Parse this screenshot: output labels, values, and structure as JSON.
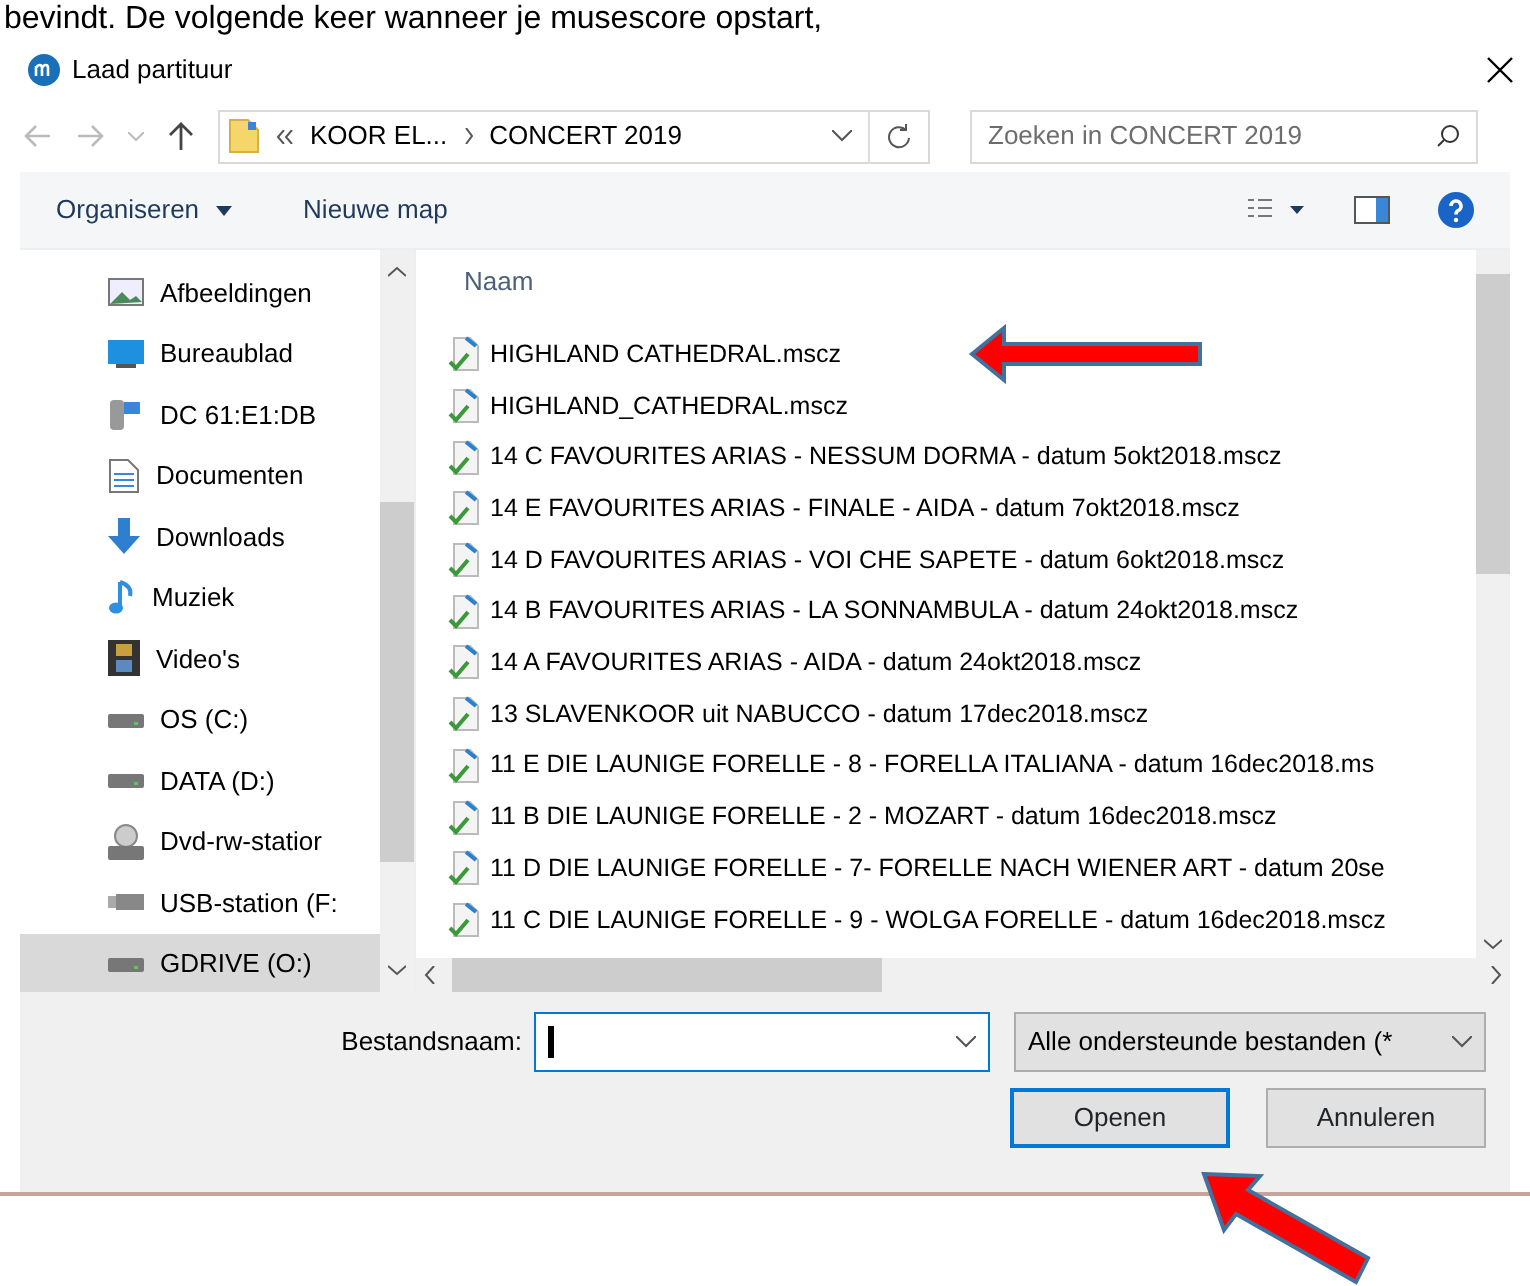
{
  "caption": "bevindt. De volgende keer wanneer je musescore opstart,",
  "window": {
    "title": "Laad partituur"
  },
  "address": {
    "crumbs": [
      "KOOR EL...",
      "CONCERT 2019"
    ]
  },
  "search": {
    "placeholder": "Zoeken in CONCERT 2019"
  },
  "toolbar": {
    "buttons": [
      "Organiseren",
      "Nieuwe map"
    ]
  },
  "sidebar": {
    "items": [
      {
        "label": "Afbeeldingen",
        "kind": "picture",
        "selected": false
      },
      {
        "label": "Bureaublad",
        "kind": "desktop",
        "selected": false
      },
      {
        "label": "DC 61:E1:DB",
        "kind": "device",
        "selected": false
      },
      {
        "label": "Documenten",
        "kind": "document",
        "selected": false
      },
      {
        "label": "Downloads",
        "kind": "download",
        "selected": false
      },
      {
        "label": "Muziek",
        "kind": "music",
        "selected": false
      },
      {
        "label": "Video's",
        "kind": "video",
        "selected": false
      },
      {
        "label": "OS (C:)",
        "kind": "drive",
        "selected": false
      },
      {
        "label": "DATA (D:)",
        "kind": "drive",
        "selected": false
      },
      {
        "label": "Dvd-rw-statior",
        "kind": "dvd",
        "selected": false
      },
      {
        "label": "USB-station (F:",
        "kind": "usb",
        "selected": false
      },
      {
        "label": "GDRIVE (O:)",
        "kind": "drive",
        "selected": true
      }
    ]
  },
  "file_list": {
    "column": "Naam",
    "files": [
      {
        "name": "HIGHLAND CATHEDRAL.mscz",
        "arrow": true
      },
      {
        "name": "HIGHLAND_CATHEDRAL.mscz",
        "arrow": false
      },
      {
        "name": "14 C FAVOURITES ARIAS - NESSUM DORMA - datum 5okt2018.mscz",
        "arrow": false
      },
      {
        "name": "14 E FAVOURITES ARIAS - FINALE - AIDA - datum 7okt2018.mscz",
        "arrow": false
      },
      {
        "name": "14 D FAVOURITES ARIAS - VOI CHE SAPETE - datum 6okt2018.mscz",
        "arrow": false
      },
      {
        "name": "14 B FAVOURITES ARIAS - LA SONNAMBULA - datum 24okt2018.mscz",
        "arrow": false
      },
      {
        "name": "14 A FAVOURITES ARIAS - AIDA - datum 24okt2018.mscz",
        "arrow": false
      },
      {
        "name": "13 SLAVENKOOR uit NABUCCO - datum 17dec2018.mscz",
        "arrow": false
      },
      {
        "name": "11 E DIE LAUNIGE FORELLE - 8 - FORELLA ITALIANA - datum 16dec2018.ms",
        "arrow": false
      },
      {
        "name": "11 B DIE LAUNIGE FORELLE - 2 - MOZART - datum 16dec2018.mscz",
        "arrow": false
      },
      {
        "name": "11 D DIE LAUNIGE FORELLE - 7-  FORELLE NACH WIENER ART - datum 20se",
        "arrow": false
      },
      {
        "name": "11 C DIE LAUNIGE FORELLE - 9 - WOLGA FORELLE - datum 16dec2018.mscz",
        "arrow": false
      }
    ]
  },
  "filename": {
    "label": "Bestandsnaam:"
  },
  "filter": "Alle ondersteunde bestanden (*",
  "buttons": [
    {
      "label": "Openen",
      "default": true,
      "arrow": true
    },
    {
      "label": "Annuleren",
      "default": false,
      "arrow": false
    }
  ]
}
